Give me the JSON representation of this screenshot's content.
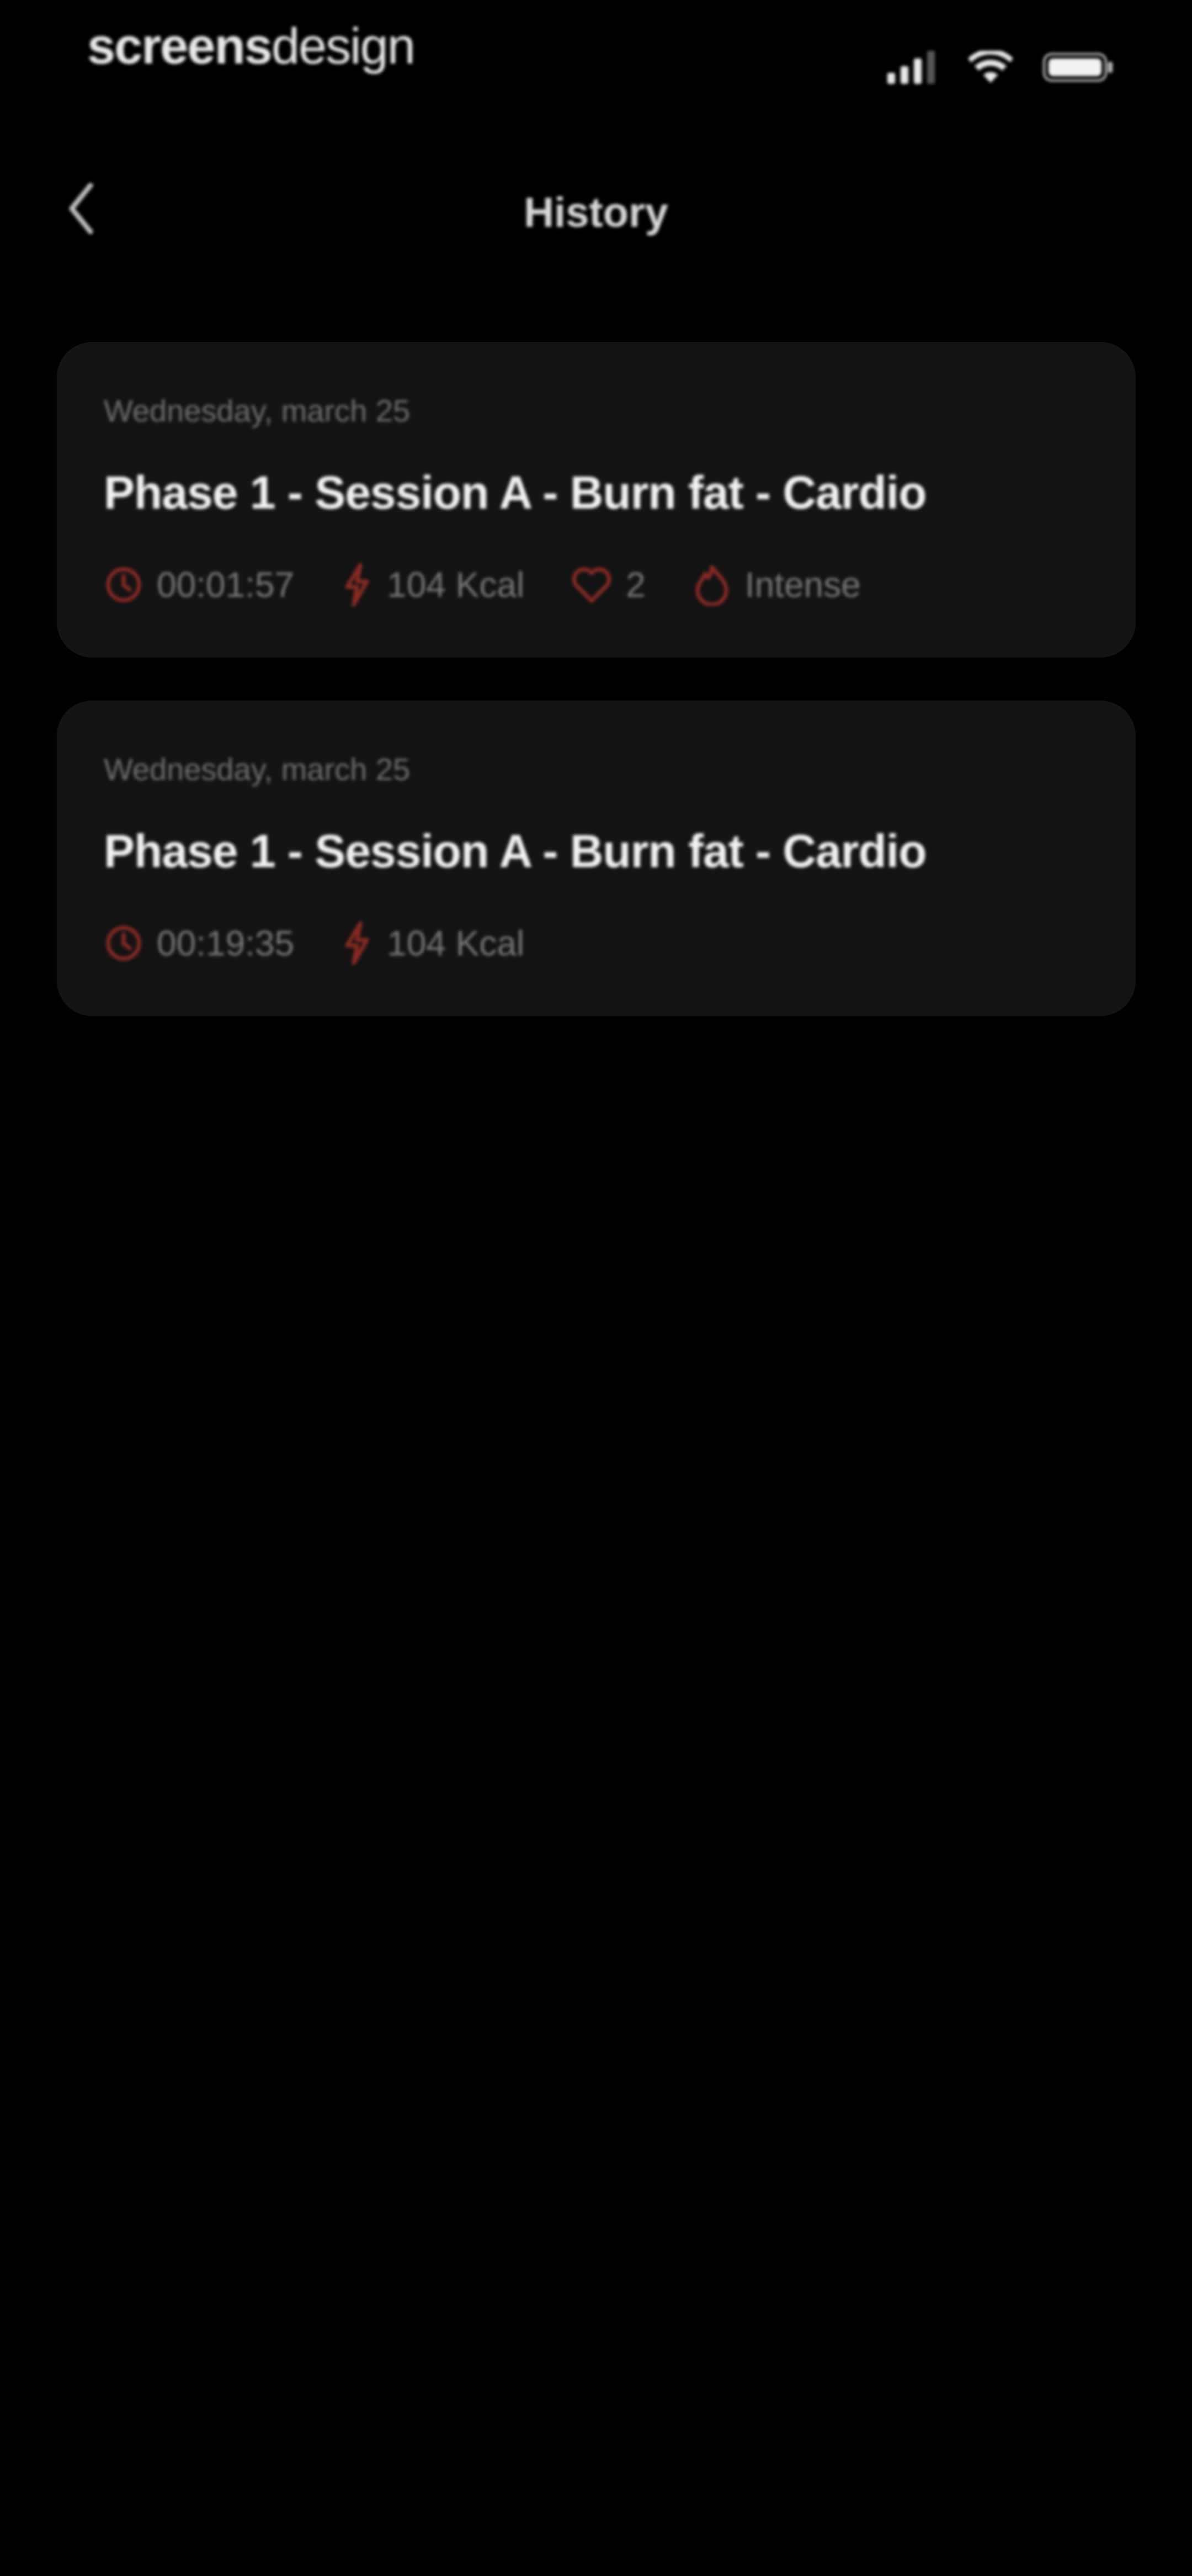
{
  "status_bar": {
    "brand_bold": "screens",
    "brand_light": "design"
  },
  "header": {
    "title": "History"
  },
  "icons": {
    "back": "chevron-left-icon",
    "duration": "clock-icon",
    "calories": "lightning-icon",
    "heart": "heart-icon",
    "intensity": "flame-icon"
  },
  "colors": {
    "background": "#000000",
    "card": "#141414",
    "accent": "#8b2a22",
    "muted_text": "#777777"
  },
  "sessions": [
    {
      "date": "Wednesday, march 25",
      "title": "Phase 1 - Session A - Burn fat - Cardio",
      "duration": "00:01:57",
      "calories": "104 Kcal",
      "hearts": "2",
      "intensity": "Intense"
    },
    {
      "date": "Wednesday, march 25",
      "title": "Phase 1 - Session A - Burn fat - Cardio",
      "duration": "00:19:35",
      "calories": "104 Kcal"
    }
  ]
}
